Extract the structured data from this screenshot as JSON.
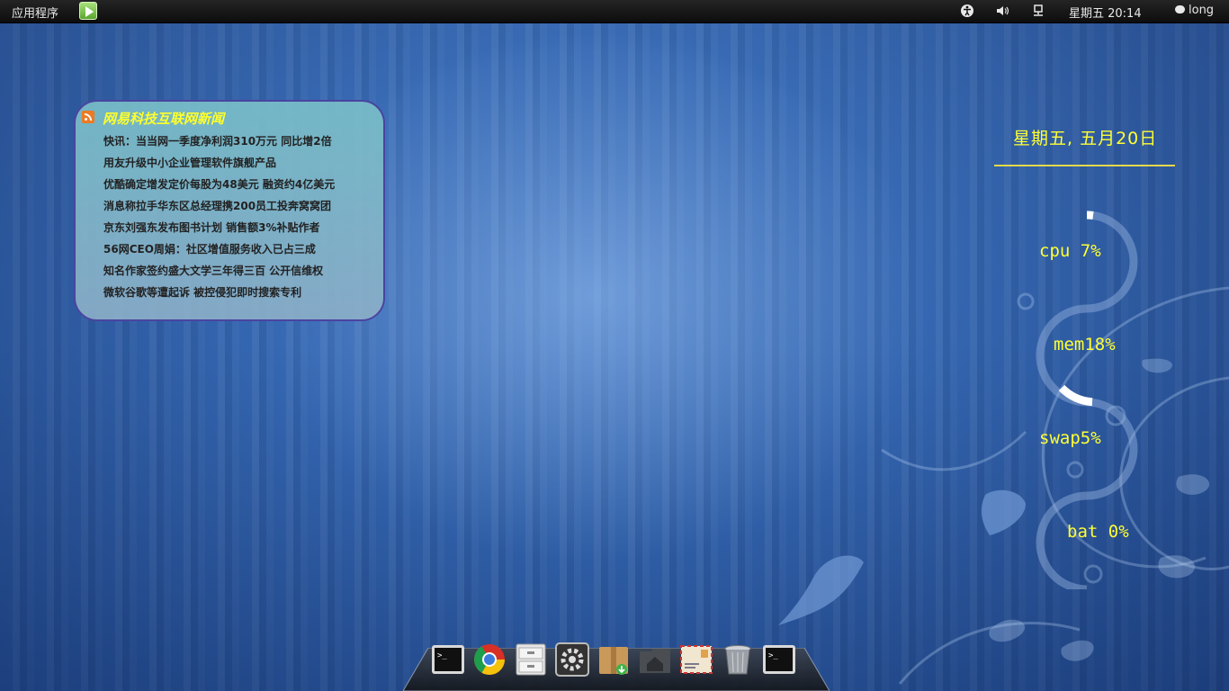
{
  "topbar": {
    "applications_label": "应用程序",
    "launcher_icon": "play-launcher-icon",
    "tray": {
      "accessibility_icon": "accessibility-icon",
      "volume_icon": "volume-icon",
      "network_icon": "network-wired-icon"
    },
    "clock": "星期五 20:14",
    "user": "long",
    "user_icon": "chat-bubble-icon"
  },
  "news_widget": {
    "title": "网易科技互联网新闻",
    "feed_icon": "rss-icon",
    "items": [
      "快讯：当当网一季度净利润310万元 同比增2倍",
      "用友升级中小企业管理软件旗舰产品",
      "优酷确定增发定价每股为48美元 融资约4亿美元",
      "消息称拉手华东区总经理携200员工投奔窝窝团",
      "京东刘强东发布图书计划 销售额3%补贴作者",
      "56网CEO周娟：社区增值服务收入已占三成",
      "知名作家签约盛大文学三年得三百 公开信维权",
      "微软谷歌等遭起诉 被控侵犯即时搜索专利"
    ]
  },
  "system_monitor": {
    "date": "星期五, 五月20日",
    "cpu": "cpu  7%",
    "mem": "mem18%",
    "swap": "swap5%",
    "bat": "bat  0%",
    "cpu_value": 7,
    "mem_value": 18,
    "swap_value": 5,
    "bat_value": 0
  },
  "dock": {
    "items": [
      {
        "name": "terminal-icon"
      },
      {
        "name": "chrome-icon"
      },
      {
        "name": "file-cabinet-icon"
      },
      {
        "name": "system-settings-icon"
      },
      {
        "name": "archive-package-icon"
      },
      {
        "name": "home-folder-icon"
      },
      {
        "name": "mail-envelope-icon"
      },
      {
        "name": "trash-icon"
      },
      {
        "name": "terminal-icon"
      }
    ]
  },
  "colors": {
    "accent_yellow": "#ffff33",
    "news_title": "#ffff2a",
    "news_border": "#4a44a0"
  }
}
